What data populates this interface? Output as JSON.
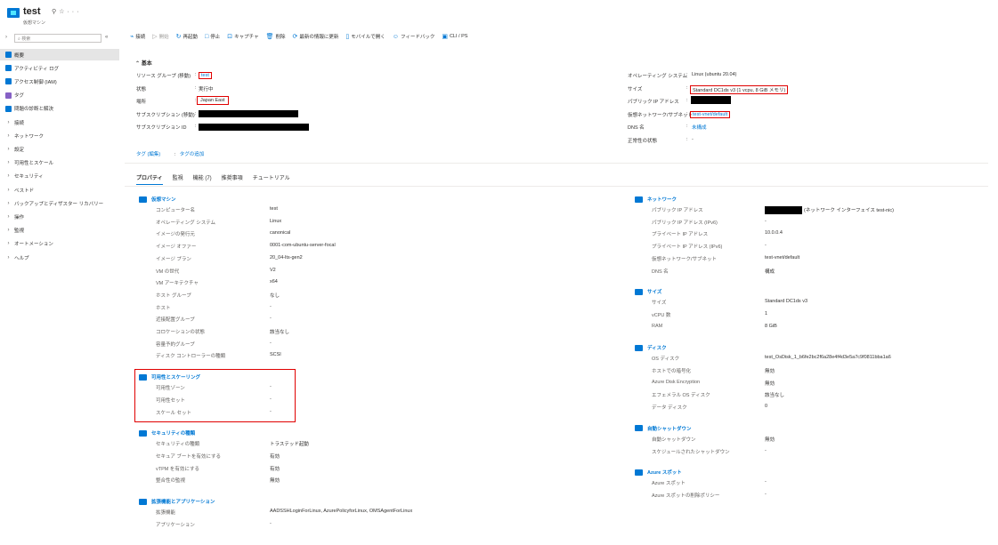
{
  "header": {
    "title": "test",
    "subtitle": "仮想マシン",
    "icons": [
      "pin-icon",
      "star-icon",
      "more-icon"
    ]
  },
  "nav": {
    "search_placeholder": "検索",
    "collapse_glyph": "«",
    "items": [
      {
        "label": "概要",
        "icon": "monitor-icon",
        "color": "#0078d4",
        "expandable": false,
        "selected": true
      },
      {
        "label": "アクティビティ ログ",
        "icon": "log-icon",
        "color": "#0078d4",
        "expandable": false
      },
      {
        "label": "アクセス制御 (IAM)",
        "icon": "iam-icon",
        "color": "#0078d4",
        "expandable": false
      },
      {
        "label": "タグ",
        "icon": "tag-icon",
        "color": "#8661c5",
        "expandable": false
      },
      {
        "label": "問題の診断と解決",
        "icon": "wrench-icon",
        "color": "#0078d4",
        "expandable": false
      },
      {
        "label": "接続",
        "expandable": true
      },
      {
        "label": "ネットワーク",
        "expandable": true
      },
      {
        "label": "設定",
        "expandable": true
      },
      {
        "label": "可用性とスケール",
        "expandable": true
      },
      {
        "label": "セキュリティ",
        "expandable": true
      },
      {
        "label": "ベストド",
        "expandable": true
      },
      {
        "label": "バックアップとディザスター リカバリー",
        "expandable": true
      },
      {
        "label": "操作",
        "expandable": true
      },
      {
        "label": "監視",
        "expandable": true
      },
      {
        "label": "オートメーション",
        "expandable": true
      },
      {
        "label": "ヘルプ",
        "expandable": true
      }
    ]
  },
  "toolbar": {
    "items": [
      {
        "label": "接続",
        "icon": "plug-icon",
        "disabled": false
      },
      {
        "label": "開始",
        "icon": "play-icon",
        "disabled": true
      },
      {
        "label": "再起動",
        "icon": "restart-icon",
        "disabled": false
      },
      {
        "label": "停止",
        "icon": "stop-icon",
        "disabled": false
      },
      {
        "label": "キャプチャ",
        "icon": "capture-icon",
        "disabled": false
      },
      {
        "label": "削除",
        "icon": "trash-icon",
        "disabled": false
      },
      {
        "label": "最新の情報に更新",
        "icon": "refresh-icon",
        "disabled": false
      },
      {
        "label": "モバイルで開く",
        "icon": "mobile-icon",
        "disabled": false
      },
      {
        "label": "フィードバック",
        "icon": "feedback-icon",
        "disabled": false
      },
      {
        "label": "CLI / PS",
        "icon": "cli-icon",
        "disabled": false
      }
    ]
  },
  "essentials": {
    "title": "基本",
    "left": [
      {
        "label": "リソース グループ (移動)",
        "value": "test",
        "link": true
      },
      {
        "label": "状態",
        "value": "実行中",
        "link": false
      },
      {
        "label": "場所",
        "value": "Japan East",
        "link": false
      },
      {
        "label": "サブスクリプション (移動)",
        "value": "",
        "link": false
      },
      {
        "label": "サブスクリプション ID",
        "value": "",
        "link": false
      }
    ],
    "right": [
      {
        "label": "オペレーティング システム",
        "value": "Linux (ubuntu 20.04)",
        "link": false
      },
      {
        "label": "サイズ",
        "value": "Standard DC1ds v3 (1 vcpu, 8 GiB メモリ)",
        "link": false
      },
      {
        "label": "パブリック IP アドレス",
        "value": "",
        "link": false
      },
      {
        "label": "仮想ネットワーク/サブネット",
        "value": "test-vnet/default",
        "link": true
      },
      {
        "label": "DNS 名",
        "value": "未構成",
        "link": true
      },
      {
        "label": "正常性の状態",
        "value": "-",
        "link": false
      }
    ],
    "tags_label": "タグ (編集)",
    "tags_value": "タグの追加"
  },
  "tabs": [
    "プロパティ",
    "監視",
    "機能 (7)",
    "推奨事項",
    "チュートリアル"
  ],
  "sections_left": [
    {
      "title": "仮想マシン",
      "icon": "vm-section-icon",
      "rows": [
        {
          "label": "コンピューター名",
          "value": "test"
        },
        {
          "label": "オペレーティング システム",
          "value": "Linux"
        },
        {
          "label": "イメージの発行元",
          "value": "canonical"
        },
        {
          "label": "イメージ オファー",
          "value": "0001-com-ubuntu-server-focal"
        },
        {
          "label": "イメージ プラン",
          "value": "20_04-lts-gen2"
        },
        {
          "label": "VM の世代",
          "value": "V2"
        },
        {
          "label": "VM アーキテクチャ",
          "value": "x64"
        },
        {
          "label": "ホスト グループ",
          "value": "なし",
          "link": true
        },
        {
          "label": "ホスト",
          "value": "-"
        },
        {
          "label": "近接配置グループ",
          "value": "-"
        },
        {
          "label": "コロケーションの状態",
          "value": "該当なし"
        },
        {
          "label": "容量予約グループ",
          "value": "-"
        },
        {
          "label": "ディスク コントローラーの種類",
          "value": "SCSI"
        }
      ]
    },
    {
      "title": "可用性とスケーリング",
      "icon": "scale-icon",
      "rows": [
        {
          "label": "可用性ゾーン",
          "value": "-"
        },
        {
          "label": "可用性セット",
          "value": "-"
        },
        {
          "label": "スケール セット",
          "value": "-"
        }
      ]
    },
    {
      "title": "セキュリティの種類",
      "icon": "security-icon",
      "rows": [
        {
          "label": "セキュリティの種類",
          "value": "トラステッド起動"
        },
        {
          "label": "セキュア ブートを有効にする",
          "value": "有効"
        },
        {
          "label": "vTPM を有効にする",
          "value": "有効"
        },
        {
          "label": "整合性の監視",
          "value": "無効"
        }
      ]
    },
    {
      "title": "拡張機能とアプリケーション",
      "icon": "extension-icon",
      "rows": [
        {
          "label": "拡張機能",
          "value": "AADSSHLoginForLinux, AzurePolicyforLinux, OMSAgentForLinux"
        },
        {
          "label": "アプリケーション",
          "value": "-"
        }
      ]
    }
  ],
  "sections_right": [
    {
      "title": "ネットワーク",
      "icon": "network-icon",
      "rows": [
        {
          "label": "パブリック IP アドレス",
          "value": "(ネットワーク インターフェイス test-nic)"
        },
        {
          "label": "パブリック IP アドレス (IPv6)",
          "value": "-"
        },
        {
          "label": "プライベート IP アドレス",
          "value": "10.0.0.4"
        },
        {
          "label": "プライベート IP アドレス (IPv6)",
          "value": "-"
        },
        {
          "label": "仮想ネットワーク/サブネット",
          "value": "test-vnet/default",
          "link": true
        },
        {
          "label": "DNS 名",
          "value": "構成",
          "link": true
        }
      ]
    },
    {
      "title": "サイズ",
      "icon": "size-icon",
      "rows": [
        {
          "label": "サイズ",
          "value": "Standard DC1ds v3"
        },
        {
          "label": "vCPU 数",
          "value": "1"
        },
        {
          "label": "RAM",
          "value": "8 GiB"
        }
      ]
    },
    {
      "title": "ディスク",
      "icon": "disk-icon",
      "rows": [
        {
          "label": "OS ディスク",
          "value": "test_OsDisk_1_b6fe2bc2f6a28e4f4d3e5a7c9f0811bba1a6"
        },
        {
          "label": "ホストでの暗号化",
          "value": "無効"
        },
        {
          "label": "Azure Disk Encryption",
          "value": "無効"
        },
        {
          "label": "エフェメラル OS ディスク",
          "value": "該当なし"
        },
        {
          "label": "データ ディスク",
          "value": "0"
        }
      ]
    },
    {
      "title": "自動シャットダウン",
      "icon": "clock-icon",
      "rows": [
        {
          "label": "自動シャットダウン",
          "value": "無効"
        },
        {
          "label": "スケジュールされたシャットダウン",
          "value": "-"
        }
      ]
    },
    {
      "title": "Azure スポット",
      "icon": "spot-icon",
      "rows": [
        {
          "label": "Azure スポット",
          "value": "-"
        },
        {
          "label": "Azure スポットの削除ポリシー",
          "value": "-"
        }
      ]
    }
  ],
  "colors": {
    "accent": "#0078d4",
    "highlight": "#e00000",
    "redaction": "#000000"
  }
}
